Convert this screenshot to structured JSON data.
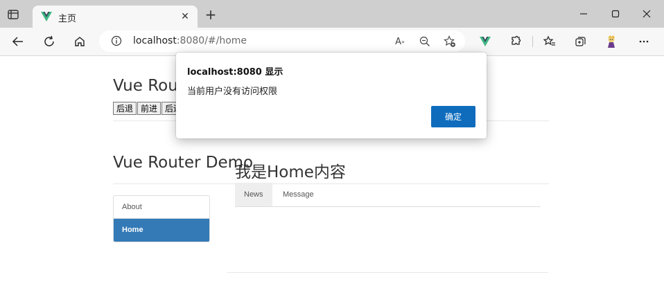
{
  "browser": {
    "tab_title": "主页",
    "url_host": "localhost",
    "url_rest": ":8080/#/home",
    "accent": "#0f6cbd"
  },
  "page": {
    "header_title_partial": "Vue Rou",
    "nav_buttons": [
      "后退",
      "前进",
      "后进"
    ],
    "main_title": "Vue Router Demo",
    "nav_items": [
      {
        "label": "About",
        "active": false
      },
      {
        "label": "Home",
        "active": true
      }
    ],
    "content_title": "我是Home内容",
    "subtabs": [
      {
        "label": "News",
        "active": true
      },
      {
        "label": "Message",
        "active": false
      }
    ],
    "active_color": "#337ab7"
  },
  "dialog": {
    "title": "localhost:8080 显示",
    "message": "当前用户没有访问权限",
    "ok_label": "确定"
  }
}
